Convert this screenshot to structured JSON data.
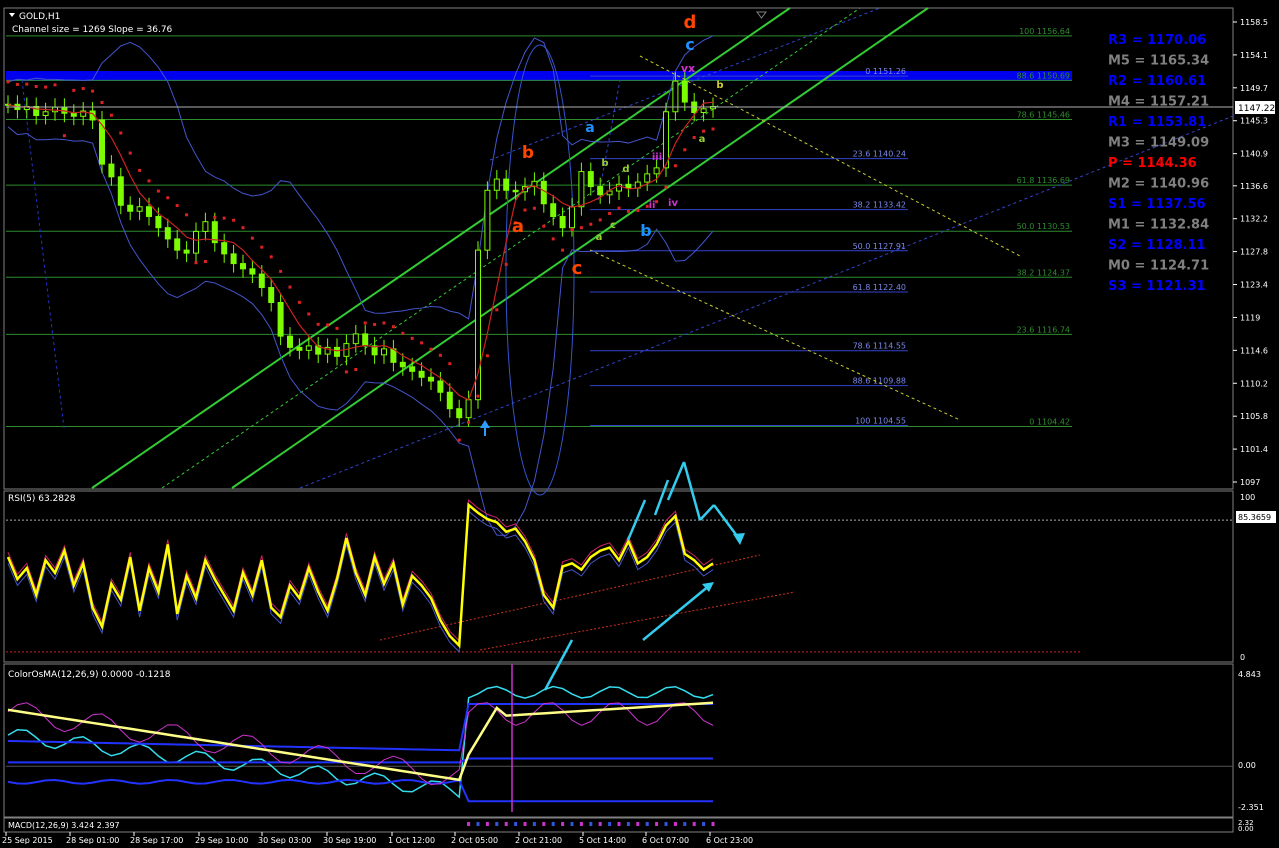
{
  "chart_data": {
    "type": "line",
    "symbol_label": "GOLD,H1",
    "subtitle": "Channel size = 1269 Slope = 36.76",
    "time_labels": [
      "25 Sep 2015",
      "28 Sep 01:00",
      "28 Sep 17:00",
      "29 Sep 10:00",
      "30 Sep 03:00",
      "30 Sep 19:00",
      "1 Oct 12:00",
      "2 Oct 05:00",
      "2 Oct 21:00",
      "5 Oct 14:00",
      "6 Oct 07:00",
      "6 Oct 23:00"
    ],
    "price_axis": {
      "ylim": [
        1097.0,
        1158.5
      ],
      "ticks": [
        1158.5,
        1154.1,
        1149.7,
        1145.3,
        1140.9,
        1136.6,
        1132.2,
        1127.8,
        1123.4,
        1119.0,
        1114.6,
        1110.2,
        1105.8,
        1101.4,
        1097.0
      ],
      "current_price": "1147.22"
    },
    "price_series": {
      "name": "GOLD H1",
      "close": [
        1147.5,
        1146.8,
        1147.2,
        1146.0,
        1146.5,
        1147.1,
        1146.3,
        1145.9,
        1146.6,
        1145.4,
        1139.5,
        1137.8,
        1134.0,
        1133.2,
        1133.8,
        1132.5,
        1131.0,
        1129.5,
        1128.0,
        1127.6,
        1130.5,
        1131.8,
        1129.0,
        1127.5,
        1126.2,
        1125.5,
        1124.8,
        1123.0,
        1121.0,
        1116.5,
        1115.0,
        1114.6,
        1115.2,
        1114.1,
        1115.0,
        1113.8,
        1115.5,
        1116.8,
        1115.2,
        1114.0,
        1114.8,
        1113.0,
        1112.4,
        1111.8,
        1111.0,
        1110.5,
        1109.0,
        1106.8,
        1105.6,
        1108.0,
        1128.0,
        1136.0,
        1137.5,
        1136.0,
        1135.8,
        1136.5,
        1137.2,
        1134.2,
        1132.5,
        1131.0,
        1133.8,
        1138.5,
        1136.5,
        1135.4,
        1135.9,
        1136.8,
        1136.3,
        1137.1,
        1138.2,
        1139.0,
        1146.5,
        1150.6,
        1147.8,
        1146.4,
        1146.9,
        1147.2
      ]
    },
    "pivot_levels": [
      {
        "name": "R3",
        "value": "1170.06",
        "color": "#0000FF"
      },
      {
        "name": "M5",
        "value": "1165.34",
        "color": "#808080"
      },
      {
        "name": "R2",
        "value": "1160.61",
        "color": "#0000FF"
      },
      {
        "name": "M4",
        "value": "1157.21",
        "color": "#808080"
      },
      {
        "name": "R1",
        "value": "1153.81",
        "color": "#0000FF"
      },
      {
        "name": "M3",
        "value": "1149.09",
        "color": "#808080"
      },
      {
        "name": "P",
        "value": "1144.36",
        "color": "#FF0000"
      },
      {
        "name": "M2",
        "value": "1140.96",
        "color": "#808080"
      },
      {
        "name": "S1",
        "value": "1137.56",
        "color": "#0000FF"
      },
      {
        "name": "M1",
        "value": "1132.84",
        "color": "#808080"
      },
      {
        "name": "S2",
        "value": "1128.11",
        "color": "#0000FF"
      },
      {
        "name": "M0",
        "value": "1124.71",
        "color": "#808080"
      },
      {
        "name": "S3",
        "value": "1121.31",
        "color": "#0000FF"
      }
    ],
    "fib_levels_green": [
      {
        "label": "100 1156.64",
        "value": 1156.64
      },
      {
        "label": "88.6 1150.69",
        "value": 1150.69
      },
      {
        "label": "78.6 1145.46",
        "value": 1145.46
      },
      {
        "label": "61.8 1136.69",
        "value": 1136.69
      },
      {
        "label": "50.0 1130.53",
        "value": 1130.53
      },
      {
        "label": "38.2 1124.37",
        "value": 1124.37
      },
      {
        "label": "23.6 1116.74",
        "value": 1116.74
      },
      {
        "label": "0 1104.42",
        "value": 1104.42
      }
    ],
    "fib_levels_blue": [
      {
        "label": "0 1151.26",
        "value": 1151.26
      },
      {
        "label": "23.6 1140.24",
        "value": 1140.24
      },
      {
        "label": "38.2 1133.42",
        "value": 1133.42
      },
      {
        "label": "50.0 1127.91",
        "value": 1127.91
      },
      {
        "label": "61.8 1122.40",
        "value": 1122.4
      },
      {
        "label": "78.6 1114.55",
        "value": 1114.55
      },
      {
        "label": "88.6 1109.88",
        "value": 1109.88
      },
      {
        "label": "100 1104.55",
        "value": 1104.55
      }
    ],
    "wave_labels": [
      {
        "text": "d",
        "color": "#FF4500"
      },
      {
        "text": "c",
        "color": "#1E90FF"
      },
      {
        "text": "vx",
        "color": "#CC33CC"
      },
      {
        "text": "b",
        "color": "#FF4500"
      },
      {
        "text": "a",
        "color": "#FF4500"
      },
      {
        "text": "c",
        "color": "#FF4500"
      },
      {
        "text": "a",
        "color": "#1E90FF"
      },
      {
        "text": "b",
        "color": "#1E90FF"
      },
      {
        "text": "iii",
        "color": "#CC33CC"
      },
      {
        "text": "ii",
        "color": "#CC33CC"
      },
      {
        "text": "iv",
        "color": "#CC33CC"
      },
      {
        "text": "b",
        "color": "#9ACD32"
      },
      {
        "text": "d",
        "color": "#9ACD32"
      },
      {
        "text": "a",
        "color": "#9ACD32"
      },
      {
        "text": "c",
        "color": "#9ACD32"
      },
      {
        "text": "b",
        "color": "#CCCC33"
      },
      {
        "text": "a",
        "color": "#9ACD32"
      }
    ],
    "rsi": {
      "title": "RSI(5) 63.2828",
      "ylim": [
        0,
        100
      ],
      "tick_labels": [
        "100",
        "0"
      ],
      "level_label": "85.3659",
      "values": [
        62,
        48,
        55,
        38,
        60,
        52,
        66,
        44,
        58,
        30,
        18,
        45,
        35,
        62,
        28,
        55,
        40,
        70,
        26,
        50,
        36,
        60,
        48,
        38,
        28,
        52,
        38,
        60,
        30,
        24,
        44,
        36,
        55,
        40,
        28,
        48,
        74,
        52,
        38,
        62,
        45,
        58,
        32,
        50,
        44,
        36,
        22,
        12,
        6,
        95,
        90,
        86,
        84,
        78,
        80,
        72,
        60,
        38,
        30,
        56,
        58,
        54,
        62,
        66,
        68,
        60,
        72,
        58,
        62,
        70,
        82,
        88,
        64,
        60,
        54,
        58
      ]
    },
    "osma": {
      "title": "ColorOsMA(12,26,9) 0.0000 -0.1218",
      "ylim": [
        -2.351,
        4.843
      ],
      "tick_labels": [
        "4.843",
        "0.00",
        "-2.351"
      ]
    },
    "macd": {
      "title": "MACD(12,26,9) 3.424 2.397",
      "tick_labels": [
        "2.32",
        "0.00"
      ]
    }
  }
}
